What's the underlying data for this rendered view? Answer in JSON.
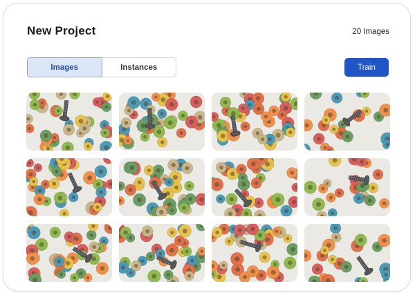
{
  "project": {
    "title": "New Project",
    "image_count": "20 Images"
  },
  "tabs": [
    {
      "label": "Images",
      "active": true
    },
    {
      "label": "Instances",
      "active": false
    }
  ],
  "toolbar": {
    "train_label": "Train"
  },
  "colors": {
    "accent": "#1f55c4",
    "tab_active_bg": "#dbe6f7",
    "tab_active_border": "#7ea2dc",
    "cereal_palette": [
      "#e0714a",
      "#4a9ab8",
      "#8fba4e",
      "#e6c24a",
      "#d95f5f",
      "#f0904a",
      "#6a9e62",
      "#c9b78a"
    ]
  },
  "gallery": {
    "images": [
      {
        "alt": "cereal-with-screw"
      },
      {
        "alt": "cereal-with-screw"
      },
      {
        "alt": "cereal-with-screw"
      },
      {
        "alt": "cereal-with-screw"
      },
      {
        "alt": "cereal-with-screw"
      },
      {
        "alt": "cereal-with-screw"
      },
      {
        "alt": "cereal-with-screw"
      },
      {
        "alt": "cereal-with-screw"
      },
      {
        "alt": "cereal-with-screw"
      },
      {
        "alt": "cereal-with-screw"
      },
      {
        "alt": "cereal-with-screw"
      },
      {
        "alt": "cereal-with-screw"
      }
    ]
  }
}
